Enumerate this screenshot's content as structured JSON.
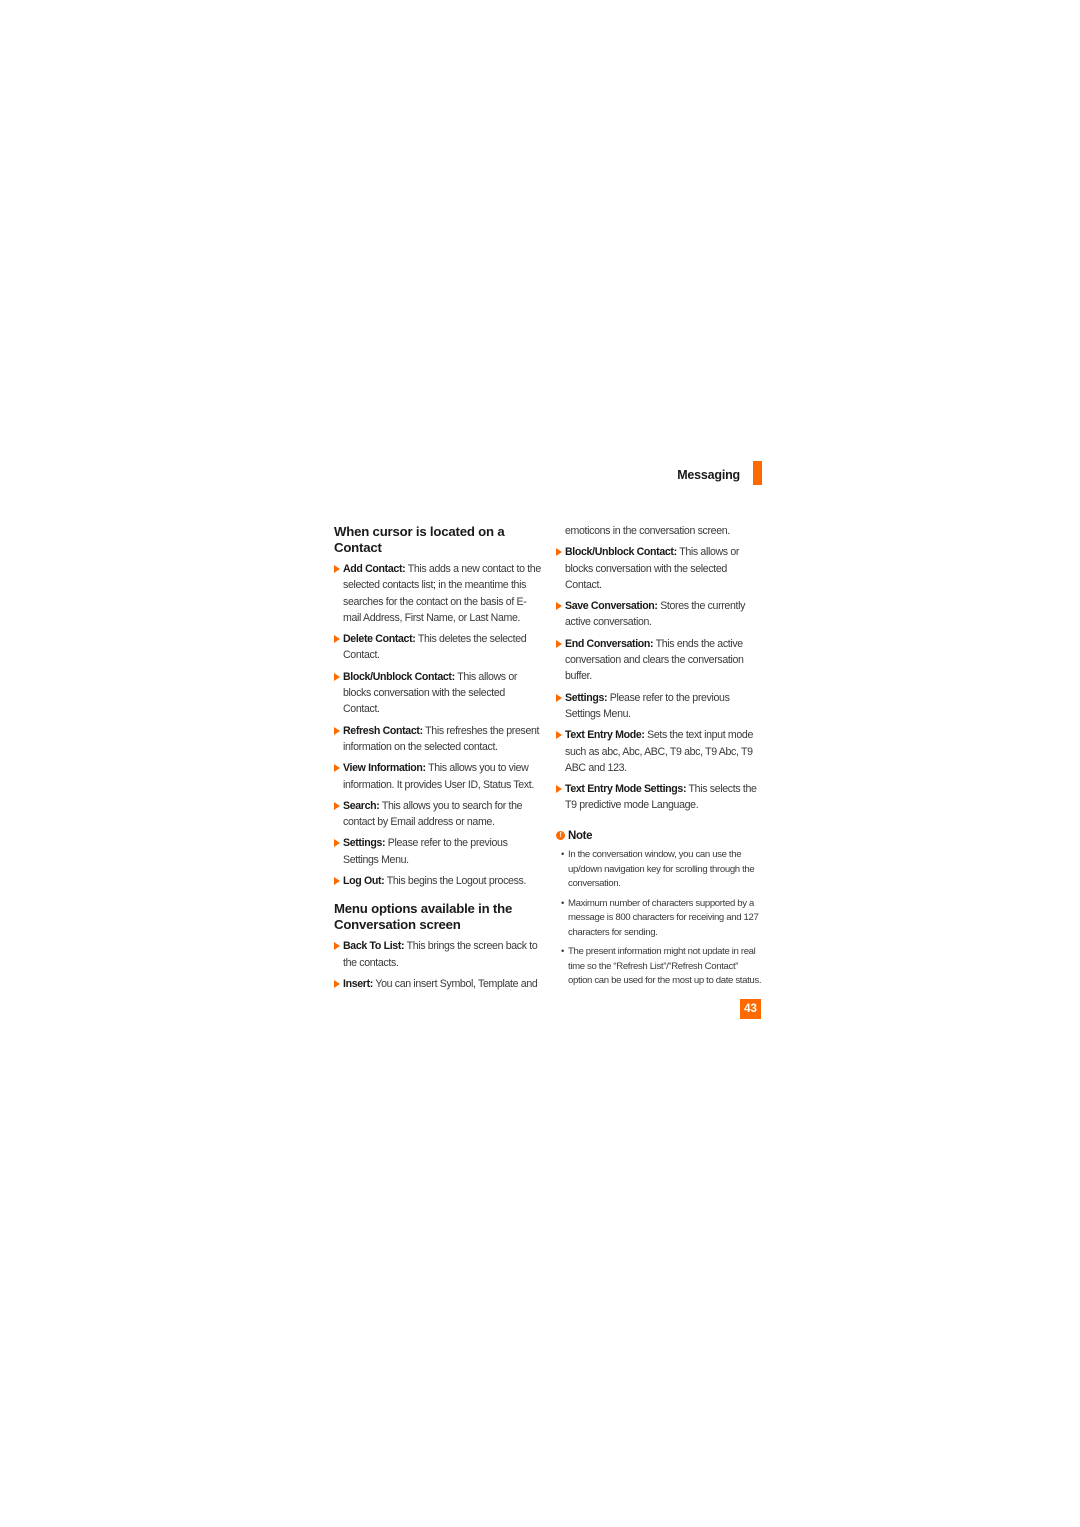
{
  "header": {
    "section_title": "Messaging",
    "accent_color": "#ff6a00"
  },
  "left_column": {
    "heading1": "When cursor is located on a Contact",
    "contact_items": [
      {
        "term": "Add Contact:",
        "text": " This adds a new contact to the selected contacts list; in the meantime this searches for the contact on the basis of E-mail Address, First Name, or Last Name."
      },
      {
        "term": "Delete Contact:",
        "text": " This deletes the selected Contact."
      },
      {
        "term": "Block/Unblock Contact:",
        "text": " This allows or blocks conversation with the selected Contact."
      },
      {
        "term": "Refresh Contact:",
        "text": " This refreshes the present information on the selected contact."
      },
      {
        "term": "View Information:",
        "text": " This allows you to view information. It provides User ID, Status Text."
      },
      {
        "term": "Search:",
        "text": " This allows you to search for the contact by Email address or name."
      },
      {
        "term": "Settings:",
        "text": " Please refer to the previous Settings Menu."
      },
      {
        "term": "Log Out:",
        "text": " This begins the Logout process."
      }
    ],
    "heading2": "Menu options available in the Conversation screen",
    "conversation_items": [
      {
        "term": "Back To List:",
        "text": " This brings the screen back to the contacts."
      },
      {
        "term": "Insert:",
        "text": " You can insert Symbol, Template and"
      }
    ]
  },
  "right_column": {
    "continuation": "emoticons in the conversation screen.",
    "conversation_items": [
      {
        "term": "Block/Unblock Contact:",
        "text": " This allows or blocks conversation with the selected Contact."
      },
      {
        "term": "Save Conversation:",
        "text": " Stores the currently active conversation."
      },
      {
        "term": "End Conversation:",
        "text": " This ends the active conversation and clears the conversation buffer."
      },
      {
        "term": "Settings:",
        "text": " Please refer to the previous Settings Menu."
      },
      {
        "term": "Text Entry Mode:",
        "text": " Sets the text input mode such as abc, Abc, ABC, T9 abc, T9 Abc, T9 ABC and 123."
      },
      {
        "term": "Text Entry Mode Settings:",
        "text": " This selects the T9 predictive mode Language."
      }
    ],
    "note": {
      "icon": "!",
      "title": "Note",
      "bullet": "•",
      "items": [
        "In the conversation window, you can use the up/down navigation key for scrolling through the conversation.",
        "Maximum number of characters supported by a message is 800 characters for receiving and 127 characters for sending.",
        "The present information might not update in real time so the “Refresh List”/“Refresh Contact” option can be used for the most up to date status."
      ]
    }
  },
  "footer": {
    "page_number": "43"
  }
}
